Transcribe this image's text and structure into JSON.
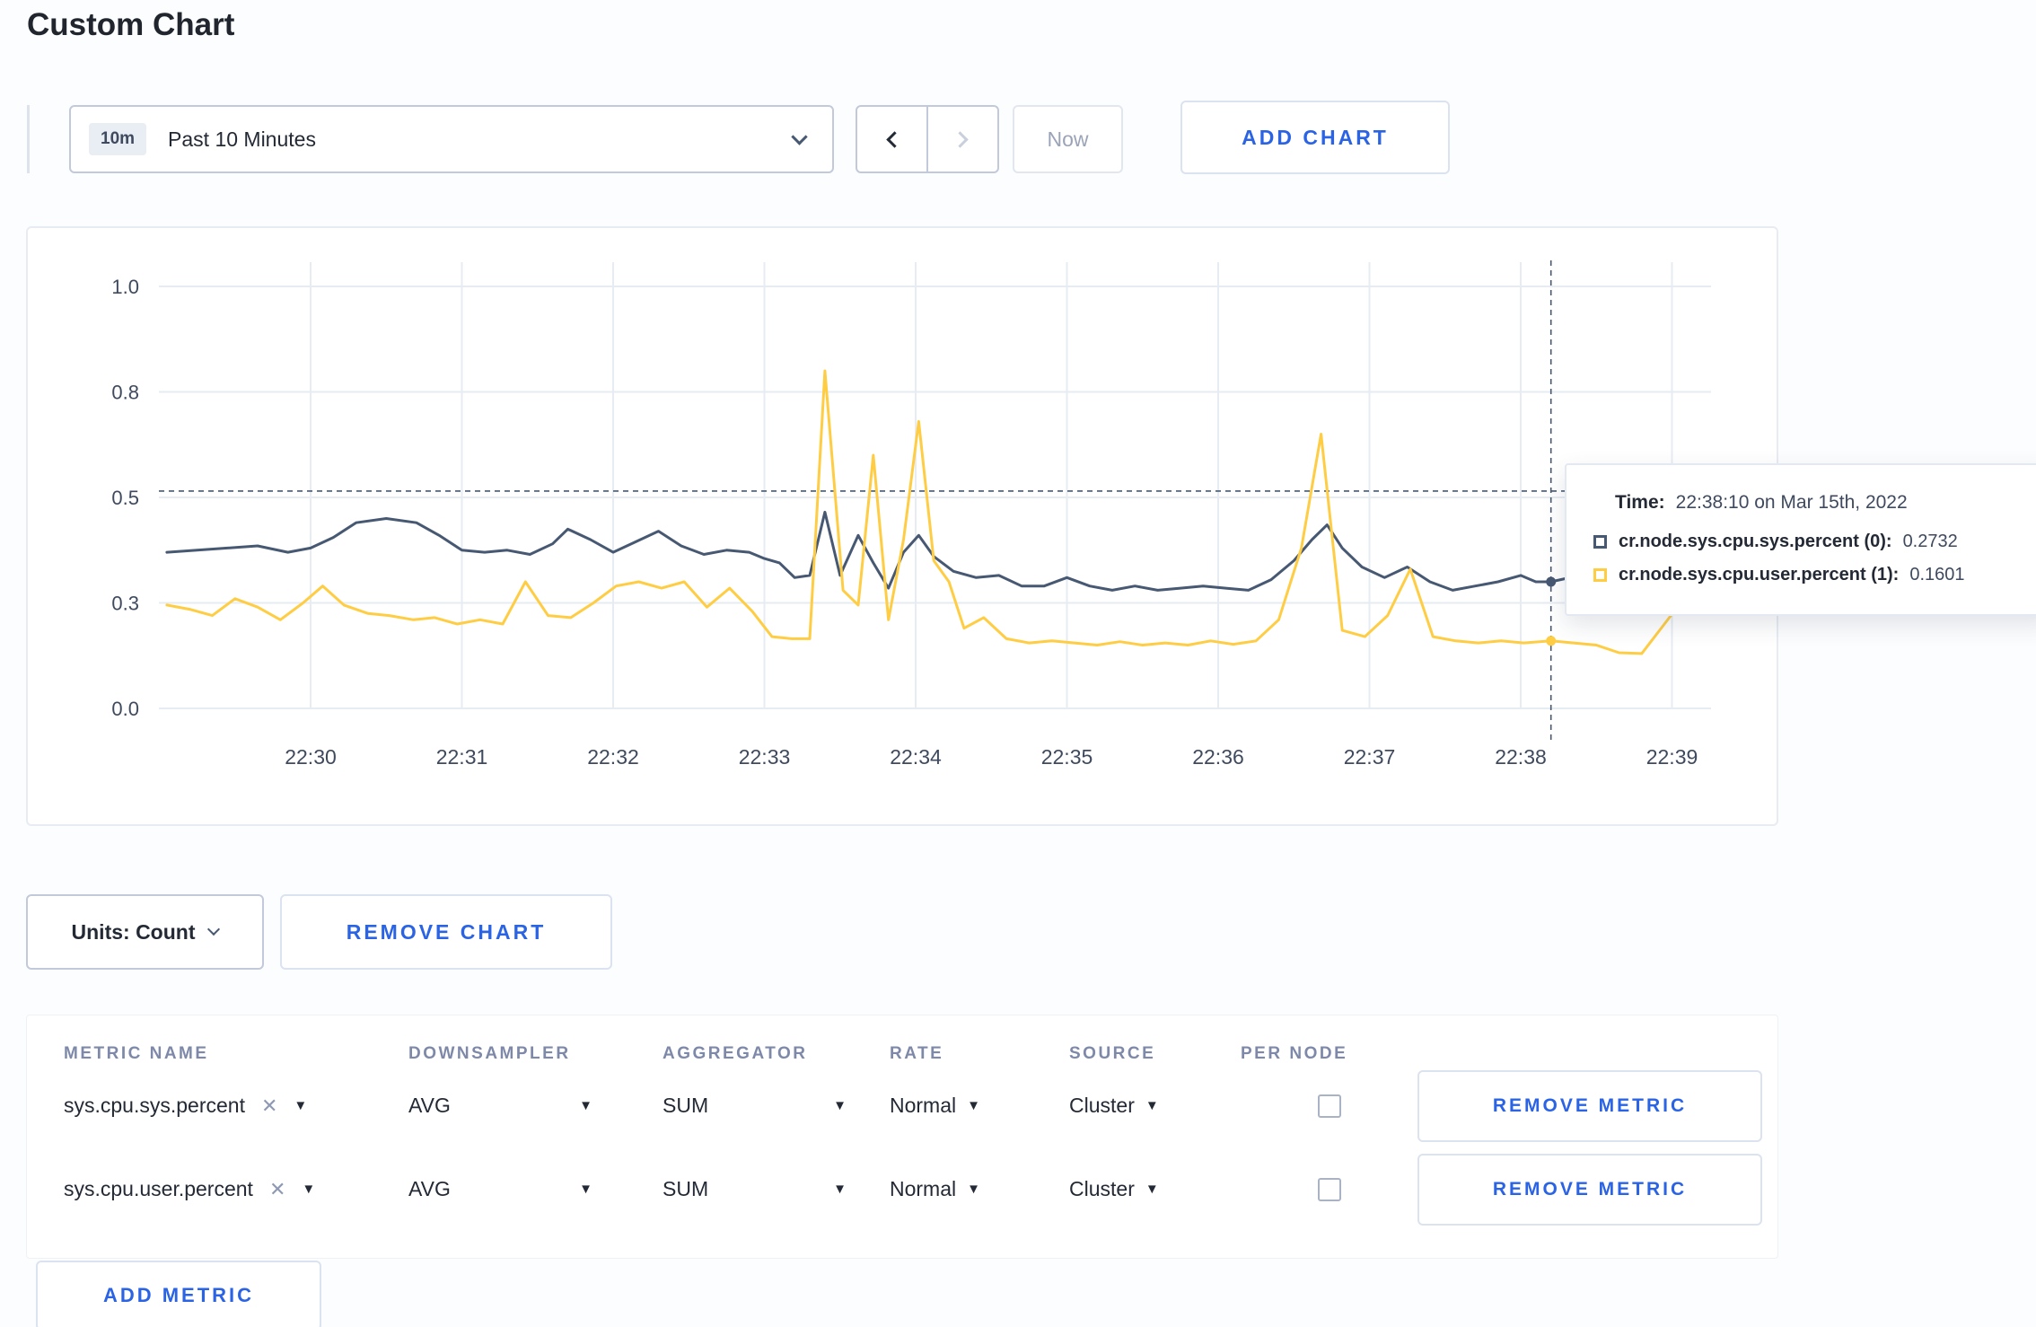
{
  "page": {
    "title": "Custom Chart"
  },
  "toolbar": {
    "time_badge": "10m",
    "time_label": "Past 10 Minutes",
    "now_label": "Now",
    "add_chart_label": "ADD CHART"
  },
  "chart_controls": {
    "units_label": "Units: Count",
    "remove_chart_label": "REMOVE CHART"
  },
  "colors": {
    "accent": "#2a63e4",
    "series_sys": "#475872",
    "series_user": "#ffcd44"
  },
  "chart_data": {
    "type": "line",
    "title": "",
    "xlabel": "",
    "ylabel": "",
    "ylim": [
      0,
      1
    ],
    "grid": true,
    "y_ticks": [
      {
        "v": 0.0,
        "label": "0.0"
      },
      {
        "v": 0.25,
        "label": "0.3"
      },
      {
        "v": 0.5,
        "label": "0.5"
      },
      {
        "v": 0.75,
        "label": "0.8"
      },
      {
        "v": 1.0,
        "label": "1.0"
      }
    ],
    "x_ticks": [
      "22:30",
      "22:31",
      "22:32",
      "22:33",
      "22:34",
      "22:35",
      "22:36",
      "22:37",
      "22:38",
      "22:39"
    ],
    "series": [
      {
        "name": "cr.node.sys.cpu.sys.percent",
        "color": "#475872",
        "points": [
          [
            0.05,
            0.37
          ],
          [
            0.25,
            0.375
          ],
          [
            0.45,
            0.38
          ],
          [
            0.65,
            0.385
          ],
          [
            0.85,
            0.37
          ],
          [
            1.0,
            0.38
          ],
          [
            1.15,
            0.405
          ],
          [
            1.3,
            0.44
          ],
          [
            1.5,
            0.45
          ],
          [
            1.7,
            0.44
          ],
          [
            1.85,
            0.41
          ],
          [
            2.0,
            0.375
          ],
          [
            2.15,
            0.37
          ],
          [
            2.3,
            0.375
          ],
          [
            2.45,
            0.365
          ],
          [
            2.6,
            0.39
          ],
          [
            2.7,
            0.425
          ],
          [
            2.85,
            0.4
          ],
          [
            3.0,
            0.37
          ],
          [
            3.15,
            0.395
          ],
          [
            3.3,
            0.42
          ],
          [
            3.45,
            0.385
          ],
          [
            3.6,
            0.365
          ],
          [
            3.75,
            0.375
          ],
          [
            3.9,
            0.37
          ],
          [
            4.0,
            0.355
          ],
          [
            4.1,
            0.345
          ],
          [
            4.2,
            0.31
          ],
          [
            4.3,
            0.315
          ],
          [
            4.4,
            0.465
          ],
          [
            4.5,
            0.315
          ],
          [
            4.62,
            0.41
          ],
          [
            4.72,
            0.345
          ],
          [
            4.82,
            0.285
          ],
          [
            4.92,
            0.37
          ],
          [
            5.02,
            0.41
          ],
          [
            5.12,
            0.36
          ],
          [
            5.25,
            0.325
          ],
          [
            5.4,
            0.31
          ],
          [
            5.55,
            0.315
          ],
          [
            5.7,
            0.29
          ],
          [
            5.85,
            0.29
          ],
          [
            6.0,
            0.31
          ],
          [
            6.15,
            0.29
          ],
          [
            6.3,
            0.28
          ],
          [
            6.45,
            0.29
          ],
          [
            6.6,
            0.28
          ],
          [
            6.75,
            0.285
          ],
          [
            6.9,
            0.29
          ],
          [
            7.05,
            0.285
          ],
          [
            7.2,
            0.28
          ],
          [
            7.35,
            0.305
          ],
          [
            7.5,
            0.35
          ],
          [
            7.62,
            0.4
          ],
          [
            7.72,
            0.435
          ],
          [
            7.82,
            0.38
          ],
          [
            7.95,
            0.335
          ],
          [
            8.1,
            0.31
          ],
          [
            8.25,
            0.335
          ],
          [
            8.4,
            0.3
          ],
          [
            8.55,
            0.28
          ],
          [
            8.7,
            0.29
          ],
          [
            8.85,
            0.3
          ],
          [
            9.0,
            0.315
          ],
          [
            9.1,
            0.3
          ],
          [
            9.2,
            0.3
          ],
          [
            9.35,
            0.312
          ],
          [
            9.5,
            0.3
          ],
          [
            9.65,
            0.295
          ],
          [
            9.8,
            0.3
          ],
          [
            9.95,
            0.302
          ],
          [
            10.1,
            0.31
          ]
        ]
      },
      {
        "name": "cr.node.sys.cpu.user.percent",
        "color": "#ffcd44",
        "points": [
          [
            0.05,
            0.245
          ],
          [
            0.2,
            0.235
          ],
          [
            0.35,
            0.22
          ],
          [
            0.5,
            0.26
          ],
          [
            0.65,
            0.24
          ],
          [
            0.8,
            0.21
          ],
          [
            0.95,
            0.25
          ],
          [
            1.08,
            0.29
          ],
          [
            1.22,
            0.245
          ],
          [
            1.38,
            0.225
          ],
          [
            1.52,
            0.22
          ],
          [
            1.68,
            0.21
          ],
          [
            1.82,
            0.215
          ],
          [
            1.97,
            0.2
          ],
          [
            2.12,
            0.21
          ],
          [
            2.27,
            0.2
          ],
          [
            2.42,
            0.3
          ],
          [
            2.57,
            0.22
          ],
          [
            2.72,
            0.215
          ],
          [
            2.87,
            0.25
          ],
          [
            3.02,
            0.29
          ],
          [
            3.17,
            0.3
          ],
          [
            3.32,
            0.285
          ],
          [
            3.47,
            0.3
          ],
          [
            3.62,
            0.24
          ],
          [
            3.77,
            0.285
          ],
          [
            3.92,
            0.23
          ],
          [
            4.05,
            0.17
          ],
          [
            4.18,
            0.165
          ],
          [
            4.3,
            0.165
          ],
          [
            4.4,
            0.8
          ],
          [
            4.52,
            0.28
          ],
          [
            4.62,
            0.245
          ],
          [
            4.72,
            0.6
          ],
          [
            4.82,
            0.21
          ],
          [
            4.92,
            0.4
          ],
          [
            5.02,
            0.68
          ],
          [
            5.12,
            0.35
          ],
          [
            5.22,
            0.3
          ],
          [
            5.32,
            0.19
          ],
          [
            5.45,
            0.215
          ],
          [
            5.6,
            0.165
          ],
          [
            5.75,
            0.155
          ],
          [
            5.9,
            0.16
          ],
          [
            6.05,
            0.155
          ],
          [
            6.2,
            0.15
          ],
          [
            6.35,
            0.158
          ],
          [
            6.5,
            0.15
          ],
          [
            6.65,
            0.155
          ],
          [
            6.8,
            0.15
          ],
          [
            6.95,
            0.16
          ],
          [
            7.1,
            0.152
          ],
          [
            7.25,
            0.16
          ],
          [
            7.4,
            0.21
          ],
          [
            7.55,
            0.38
          ],
          [
            7.68,
            0.65
          ],
          [
            7.82,
            0.185
          ],
          [
            7.97,
            0.17
          ],
          [
            8.12,
            0.22
          ],
          [
            8.27,
            0.33
          ],
          [
            8.42,
            0.17
          ],
          [
            8.57,
            0.16
          ],
          [
            8.72,
            0.155
          ],
          [
            8.87,
            0.16
          ],
          [
            9.02,
            0.155
          ],
          [
            9.2,
            0.16
          ],
          [
            9.35,
            0.155
          ],
          [
            9.5,
            0.15
          ],
          [
            9.65,
            0.132
          ],
          [
            9.8,
            0.13
          ],
          [
            9.95,
            0.2
          ],
          [
            10.1,
            0.27
          ]
        ]
      }
    ],
    "crosshair": {
      "m": 9.2,
      "hline_v": 0.515,
      "dots": [
        [
          9.2,
          0.3
        ],
        [
          9.2,
          0.16
        ]
      ]
    },
    "legend_position": "tooltip"
  },
  "tooltip": {
    "time_label": "Time:",
    "time_value": "22:38:10 on Mar 15th, 2022",
    "rows": [
      {
        "name": "cr.node.sys.cpu.sys.percent (0):",
        "value": "0.2732",
        "color": "#475872"
      },
      {
        "name": "cr.node.sys.cpu.user.percent (1):",
        "value": "0.1601",
        "color": "#ffcd44"
      }
    ]
  },
  "metrics_table": {
    "headers": {
      "metric": "METRIC NAME",
      "downsampler": "DOWNSAMPLER",
      "aggregator": "AGGREGATOR",
      "rate": "RATE",
      "source": "SOURCE",
      "per_node": "PER NODE"
    },
    "rows": [
      {
        "metric": "sys.cpu.sys.percent",
        "downsampler": "AVG",
        "aggregator": "SUM",
        "rate": "Normal",
        "source": "Cluster",
        "per_node": false,
        "remove_label": "REMOVE METRIC"
      },
      {
        "metric": "sys.cpu.user.percent",
        "downsampler": "AVG",
        "aggregator": "SUM",
        "rate": "Normal",
        "source": "Cluster",
        "per_node": false,
        "remove_label": "REMOVE METRIC"
      }
    ],
    "add_metric_label": "ADD METRIC"
  }
}
